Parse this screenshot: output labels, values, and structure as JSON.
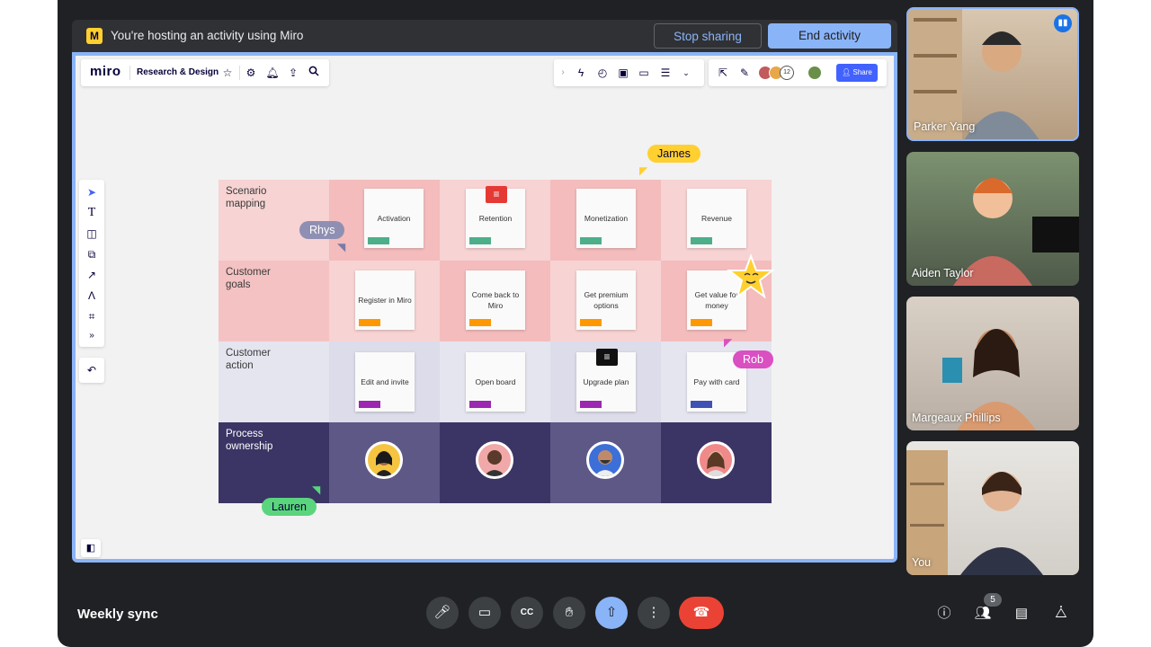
{
  "banner": {
    "message": "You're hosting an activity using Miro",
    "stop_label": "Stop sharing",
    "end_label": "End activity",
    "logo_letter": "M"
  },
  "miro": {
    "logo": "miro",
    "board_name": "Research & Design",
    "left_icons": [
      "star-icon",
      "gear-icon",
      "bell-icon",
      "upload-icon",
      "search-icon"
    ],
    "right_icons": [
      "chevron-right-icon",
      "lightning-icon",
      "timer-icon",
      "present-icon",
      "comment-icon",
      "notes-icon",
      "more-icon"
    ],
    "collab_count": "12",
    "share_label": "Share",
    "tools": [
      "cursor-icon",
      "text-icon",
      "sticky-note-icon",
      "shapes-icon",
      "pen-icon",
      "connector-icon",
      "frame-icon",
      "more-tools-icon"
    ],
    "rows": [
      {
        "label": "Scenario\nmapping",
        "stickies": [
          "Activation",
          "Retention",
          "Monetization",
          "Revenue"
        ],
        "tag": "#4caf8a"
      },
      {
        "label": "Customer\ngoals",
        "stickies": [
          "Register in Miro",
          "Come back to Miro",
          "Get premium options",
          "Get value for money"
        ],
        "tag": "#ff9800"
      },
      {
        "label": "Customer\naction",
        "stickies": [
          "Edit and invite",
          "Open board",
          "Upgrade plan",
          "Pay with card"
        ],
        "tags": [
          "#9c27b0",
          "#9c27b0",
          "#9c27b0",
          "#3f51b5"
        ]
      },
      {
        "label": "Process\nownership"
      }
    ],
    "cursors": {
      "james": "James",
      "rhys": "Rhys",
      "rob": "Rob",
      "lauren": "Lauren"
    }
  },
  "participants": [
    {
      "name": "Parker Yang",
      "speaking": true
    },
    {
      "name": "Aiden Taylor"
    },
    {
      "name": "Margeaux Phillips"
    },
    {
      "name": "You"
    }
  ],
  "meeting": {
    "title": "Weekly sync",
    "people_count": "5"
  },
  "controls": [
    "mic-icon",
    "camera-icon",
    "captions-icon",
    "raise-hand-icon",
    "present-icon",
    "more-icon",
    "end-call-icon"
  ],
  "right_controls": [
    "info-icon",
    "people-icon",
    "chat-icon",
    "activities-icon"
  ],
  "colors": {
    "accent": "#8ab4f8",
    "end_call": "#ea4335",
    "miro_yellow": "#ffd02f",
    "share_blue": "#4262ff"
  }
}
